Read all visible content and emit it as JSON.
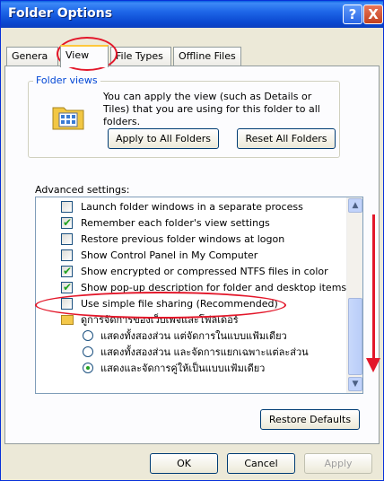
{
  "window": {
    "title": "Folder Options",
    "help_glyph": "?",
    "close_glyph": "X"
  },
  "tabs": [
    {
      "label": "Genera",
      "active": false
    },
    {
      "label": "View",
      "active": true
    },
    {
      "label": "File Types",
      "active": false
    },
    {
      "label": "Offline Files",
      "active": false
    }
  ],
  "folder_views": {
    "title": "Folder views",
    "description": "You can apply the view (such as Details or Tiles) that you are using for this folder to all folders.",
    "apply_label": "Apply to All Folders",
    "reset_label": "Reset All Folders"
  },
  "advanced": {
    "label": "Advanced settings:",
    "items": [
      {
        "kind": "checkbox",
        "text": "Launch folder windows in a separate process",
        "checked": false
      },
      {
        "kind": "checkbox",
        "text": "Remember each folder's view settings",
        "checked": true
      },
      {
        "kind": "checkbox",
        "text": "Restore previous folder windows at logon",
        "checked": false
      },
      {
        "kind": "checkbox",
        "text": "Show Control Panel in My Computer",
        "checked": false
      },
      {
        "kind": "checkbox",
        "text": "Show encrypted or compressed NTFS files in color",
        "checked": true
      },
      {
        "kind": "checkbox",
        "text": "Show pop-up description for folder and desktop items",
        "checked": true
      },
      {
        "kind": "checkbox",
        "text": "Use simple file sharing (Recommended)",
        "checked": false
      },
      {
        "kind": "folder",
        "text": "ดูการจัดการของเว็บเพจและโฟลเดอร์"
      },
      {
        "kind": "radio",
        "text": "แสดงทั้งสองส่วน แต่จัดการในแบบแฟ้มเดียว",
        "checked": false
      },
      {
        "kind": "radio",
        "text": "แสดงทั้งสองส่วน และจัดการแยกเฉพาะแต่ละส่วน",
        "checked": false
      },
      {
        "kind": "radio",
        "text": "แสดงและจัดการคู่ให้เป็นแบบแฟ้มเดียว",
        "checked": true
      }
    ],
    "restore_label": "Restore Defaults"
  },
  "footer": {
    "ok_label": "OK",
    "cancel_label": "Cancel",
    "apply_label": "Apply"
  },
  "colors": {
    "accent": "#0046d5",
    "annotation": "#e3172a",
    "title_bar": "#0a48d0"
  },
  "icons": [
    "help-icon",
    "close-icon",
    "folder-icon",
    "scroll-up-icon",
    "scroll-down-icon",
    "checkmark-icon"
  ]
}
